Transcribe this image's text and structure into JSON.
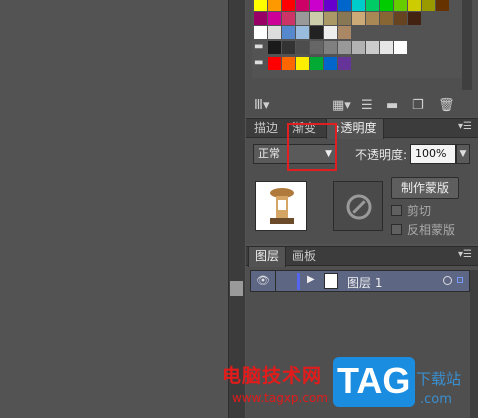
{
  "swatch_rows": [
    [
      "#ffff00",
      "#ff9900",
      "#ff0000",
      "#cc0066",
      "#cc00cc",
      "#6600cc",
      "#0066cc",
      "#00cccc",
      "#00cc66",
      "#00cc00",
      "#66cc00",
      "#cccc00",
      "#999900",
      "#663300"
    ],
    [
      "#990066",
      "#cc0099",
      "#cc3366",
      "#999999",
      "#ccccaa",
      "#aa9966",
      "#887755",
      "#ccaa77",
      "#aa8855",
      "#886633",
      "#664422",
      "#442211"
    ],
    [
      "#ffffff",
      "#dddddd",
      "#5588cc",
      "#99bbdd",
      "#222222",
      "#eeeeee",
      "#aa8866"
    ],
    [
      "folder",
      "#1a1a1a",
      "#333333",
      "#4d4d4d",
      "#666666",
      "#808080",
      "#999999",
      "#b3b3b3",
      "#cccccc",
      "#e6e6e6",
      "#ffffff"
    ],
    [
      "folder",
      "#ff0000",
      "#ff6600",
      "#ffee00",
      "#00aa33",
      "#0066cc",
      "#663399"
    ]
  ],
  "swatch_toolbar": {
    "library_icon": "swatch-library-icon",
    "icons": [
      "swatch-kind-icon",
      "swatch-options-icon",
      "new-color-group-icon",
      "new-swatch-icon",
      "delete-swatch-icon"
    ]
  },
  "transparency_panel": {
    "tabs": [
      "描边",
      "渐变",
      "透明度"
    ],
    "blend_mode": "正常",
    "opacity_label": "不透明度:",
    "opacity_value": "100%",
    "make_mask_button": "制作蒙版",
    "clip_label": "剪切",
    "invert_label": "反相蒙版"
  },
  "layers_panel": {
    "tabs": [
      "图层",
      "画板"
    ],
    "layer_name": "图层 1"
  },
  "watermark": {
    "site_name": "电脑技术网",
    "site_url": "www.tagxp.com",
    "logo_text": "TAG",
    "partial_text": "下载站",
    "partial_url": ".com"
  },
  "colors": {
    "highlight": "#e02020",
    "layer_color": "#5566ee"
  }
}
